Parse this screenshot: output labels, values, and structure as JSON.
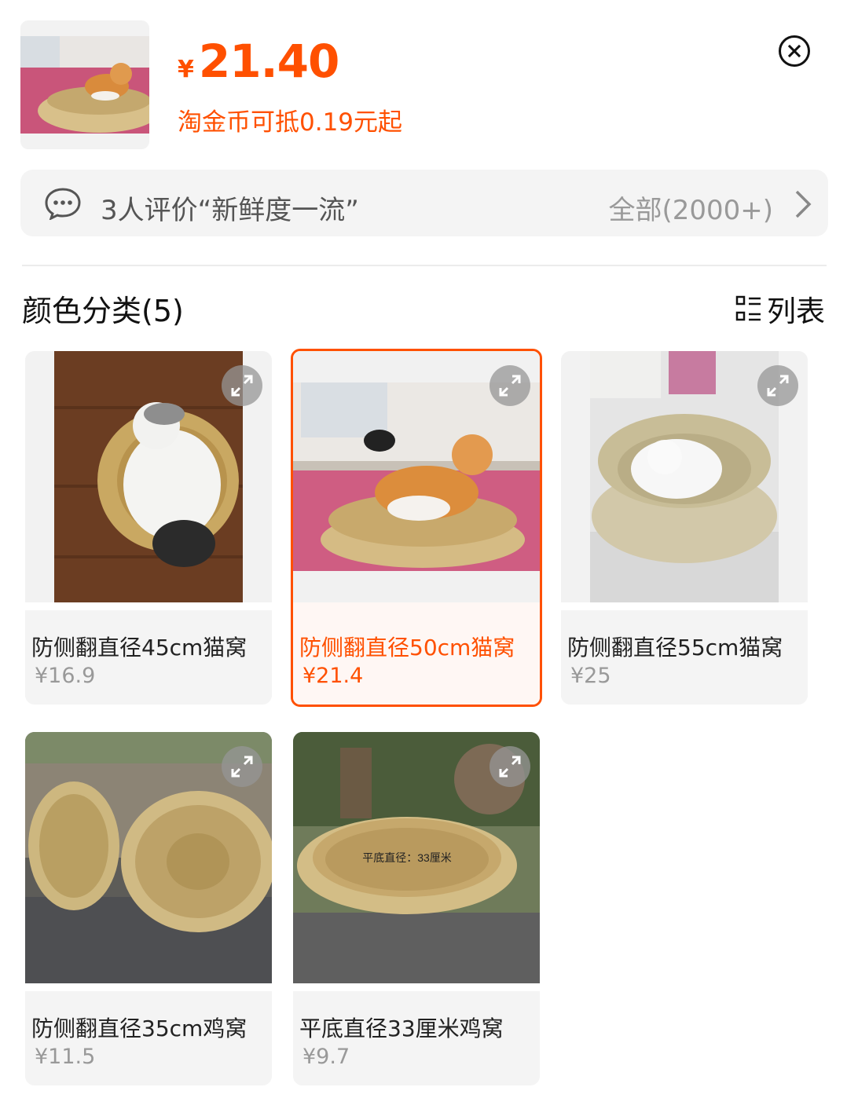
{
  "header": {
    "currency": "¥",
    "price": "21.40",
    "coin_note": "淘金币可抵0.19元起"
  },
  "review": {
    "text": "3人评价“新鲜度一流”",
    "all_label": "全部(2000+)"
  },
  "section": {
    "title": "颜色分类(5)",
    "list_label": "列表"
  },
  "options": [
    {
      "name": "防侧翻直径45cm猫窝",
      "price": "¥16.9",
      "selected": false
    },
    {
      "name": "防侧翻直径50cm猫窝",
      "price": "¥21.4",
      "selected": true
    },
    {
      "name": "防侧翻直径55cm猫窝",
      "price": "¥25",
      "selected": false
    },
    {
      "name": "防侧翻直径35cm鸡窝",
      "price": "¥11.5",
      "selected": false
    },
    {
      "name": "平底直径33厘米鸡窝",
      "price": "¥9.7",
      "selected": false
    }
  ],
  "image_caption_5": "平底直径：33厘米",
  "colors": {
    "accent": "#ff5000",
    "muted": "#999999",
    "panel": "#f4f4f4"
  }
}
